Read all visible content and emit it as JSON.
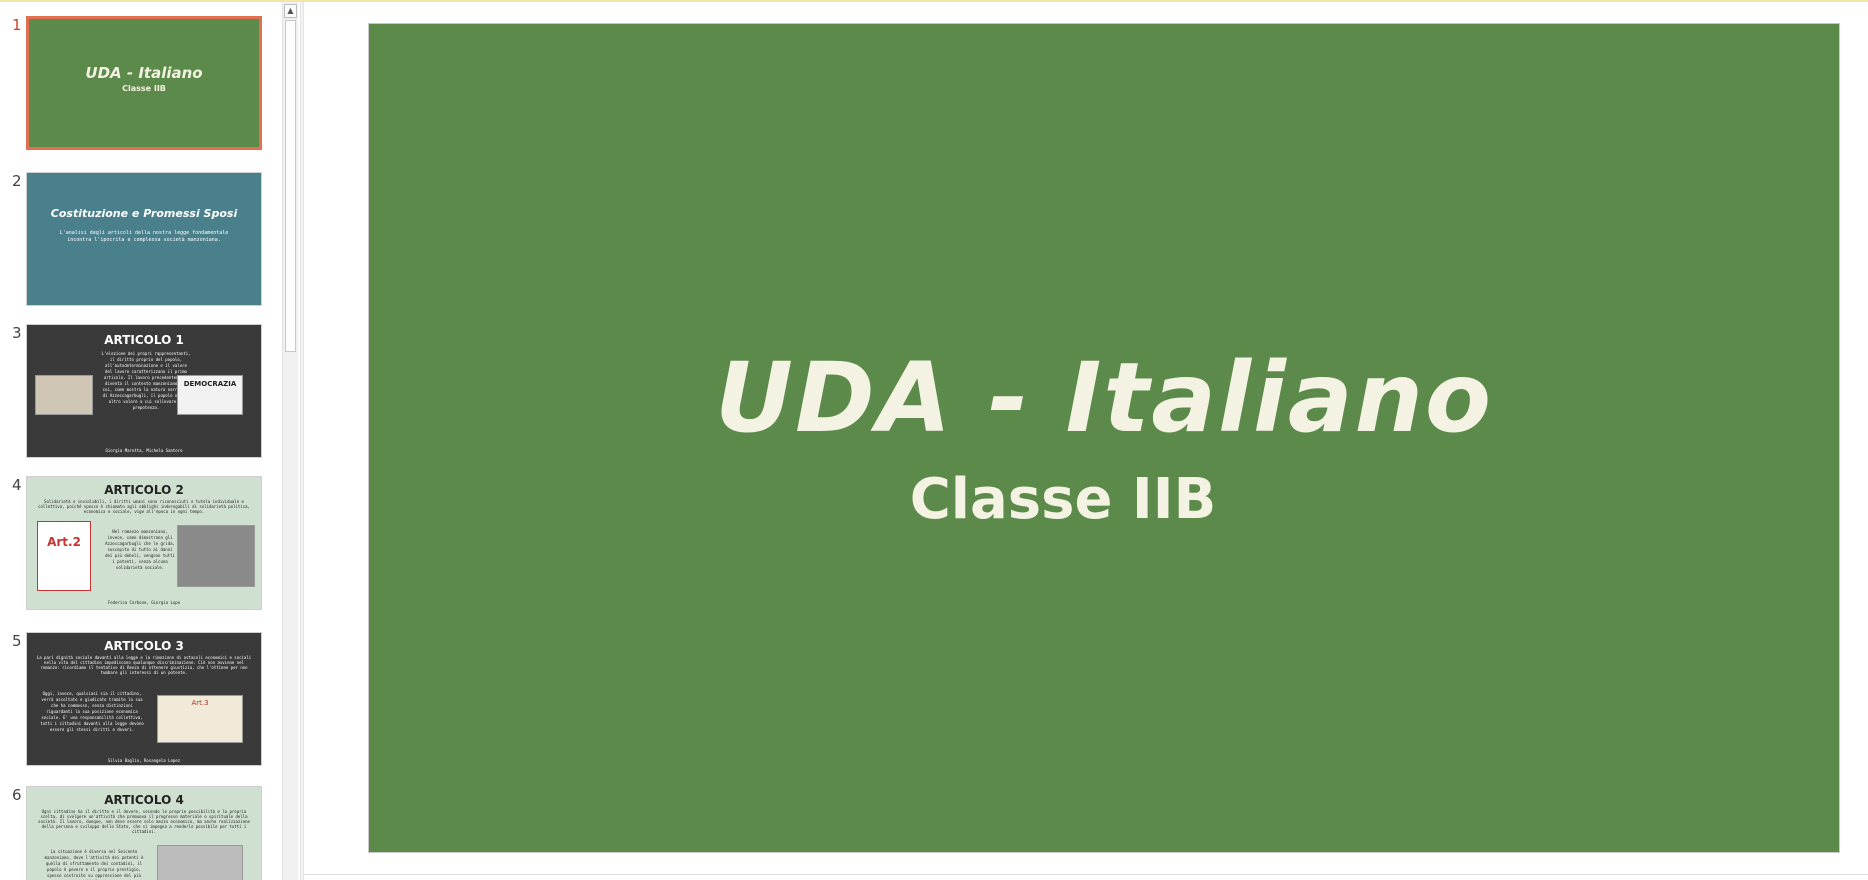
{
  "slides": [
    {
      "number": "1",
      "title": "UDA - Italiano",
      "subtitle": "Classe IIB",
      "bg": "#5c8a4a"
    },
    {
      "number": "2",
      "title": "Costituzione e Promessi Sposi",
      "text": "L'analisi degli articoli della nostra legge fondamentale incontra l'ipocrita e complessa società manzoniana.",
      "bg": "#4a7f8c"
    },
    {
      "number": "3",
      "title": "ARTICOLO 1",
      "text": "L'elezione dei propri rappresentanti, il diritto proprio del popolo, all'autodeterminazione e il valore del lavoro caratterizzano il primo articolo. Il lavoro precedentemente diventa il contesto manzoniano, in cui, come mostra la natura narrativa di Azzeccagarbugli, il popolo non ha altro valore a cui sollevare la prepotenza.",
      "authors": "Giorgia Marotta, Michela Santoro",
      "img_label": "DEMOCRAZIA",
      "bg": "#3a3a3a"
    },
    {
      "number": "4",
      "title": "ARTICOLO 2",
      "text": "Solidarietà e inviolabili, i diritti umani sono riconosciuti e tutela individuale e collettiva, poiché spesso è chiamato agli obblighi inderogabili di solidarietà politica, economica e sociale, vige all'epoca in ogni tempo.",
      "side_text": "Nel romanzo manzoniano, invece, come dimostrano gli Azzeccagarbugli che le grida, suscepite di tutto ai danni dei più deboli, vengono tutti i potenti, senza alcuna solidarietà sociale.",
      "authors": "Federica Carbone, Giorgia Lupo",
      "img_label": "Art.2",
      "bg": "#cfe0d0"
    },
    {
      "number": "5",
      "title": "ARTICOLO 3",
      "text": "La pari dignità sociale davanti alla legge e la rimozione di ostacoli economici e sociali nella vita del cittadino impediscono qualunque discriminazione. Ciò non avviene nel romanzo: ricordiamo il tentativo di Renzo di ottenere giustizia, che l'ottiene per non tumbare gli interessi di un potente.",
      "side_text": "Oggi, invece, qualsiasi sia il cittadino, verrà ascoltato e giudicato tramite la sua che ha commesso, senza distinzioni riguardanti la sua posizione economica sociale. E' una responsabilità collettiva, tutti i cittadini davanti alla legge devono essere gli stessi diritti e doveri.",
      "authors": "Silvia Baglio, Rosangela Lopez",
      "img_label": "Art.3",
      "bg": "#3a3a3a"
    },
    {
      "number": "6",
      "title": "ARTICOLO 4",
      "text": "Ogni cittadino ha il diritto e il dovere, secondo le proprie possibilità e la propria scelta, di svolgere un'attività che promuova il progresso materiale o spirituale della società. Il lavoro, dunque, non deve essere solo mezzo economico, ma anche realizzazione della persona e sviluppo dello Stato, che si impegna a renderlo possibile per tutti i cittadini.",
      "side_text": "La situazione è diversa nel Seicento manzoniano, dove l'attività dei potenti è quella di sfruttamento dei contadini, il popolo è povero e il proprio prestigio, spesso costruito su oppressione del più debole.",
      "bg": "#cfe0d0"
    }
  ],
  "main_slide": {
    "title": "UDA - Italiano",
    "subtitle": "Classe IIB"
  }
}
